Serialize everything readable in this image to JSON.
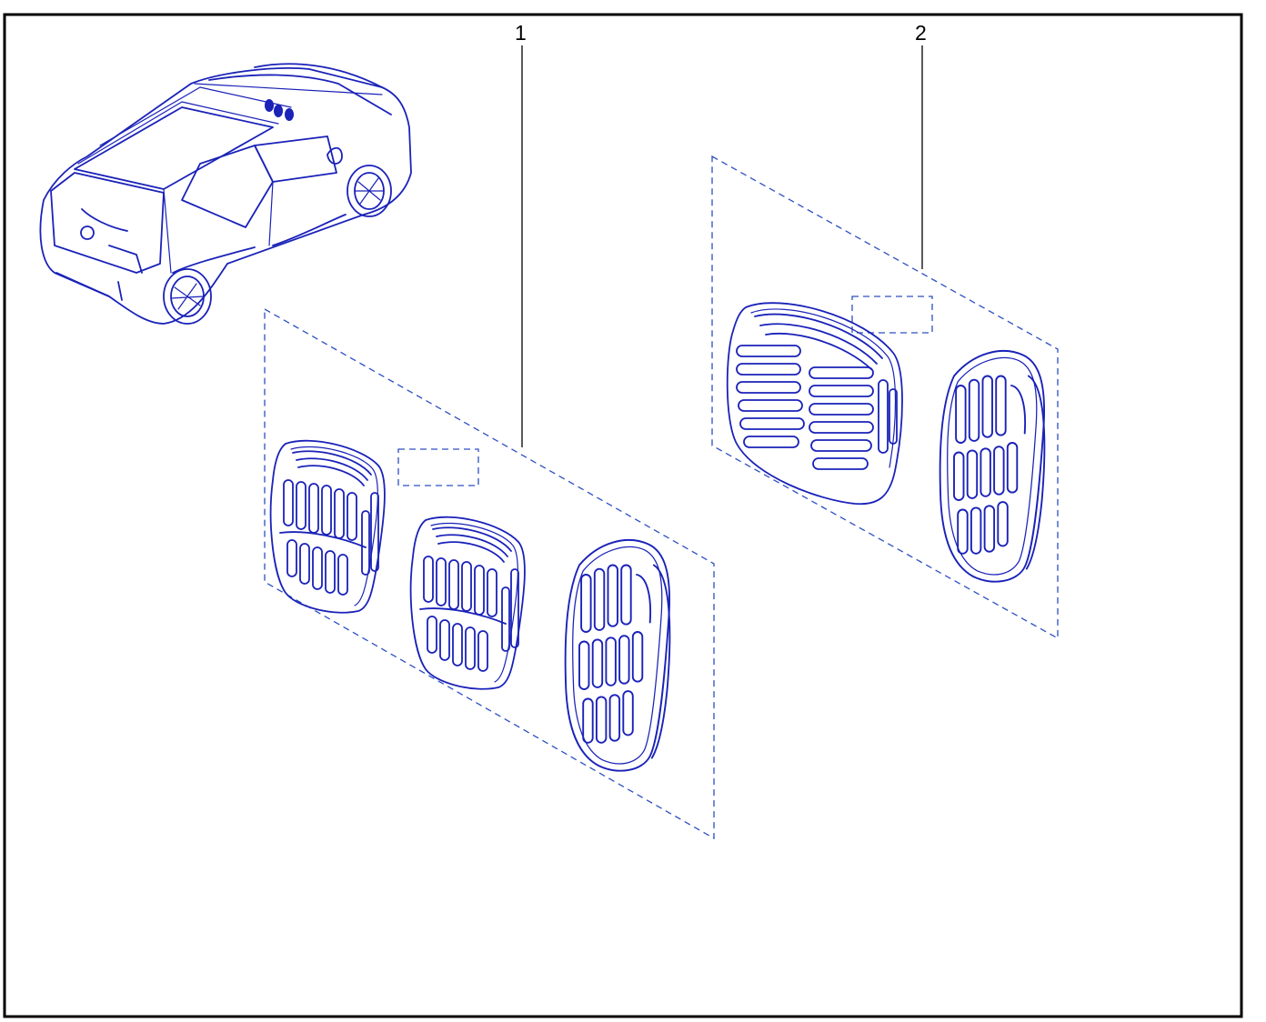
{
  "callouts": [
    {
      "id": "1",
      "label": "1"
    },
    {
      "id": "2",
      "label": "2"
    }
  ],
  "colors": {
    "line_art": "#1a22b8",
    "dashed_outline": "#2d4fc2",
    "callout_text": "#000000",
    "frame": "#000000",
    "background": "#ffffff"
  },
  "parts": [
    {
      "callout": "1",
      "description_icons": [
        "clutch-pedal-pad-icon",
        "brake-pedal-pad-icon",
        "accelerator-pedal-pad-icon"
      ]
    },
    {
      "callout": "2",
      "description_icons": [
        "brake-pedal-pad-wide-icon",
        "accelerator-pedal-pad-icon"
      ]
    }
  ]
}
